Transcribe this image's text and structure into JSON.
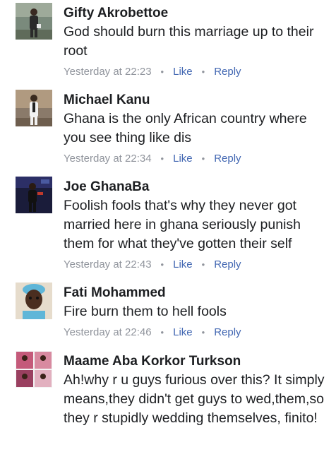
{
  "comments": [
    {
      "author": "Gifty Akrobettoe",
      "text": "God should burn this marriage up to their root",
      "time": "Yesterday at 22:23",
      "like": "Like",
      "reply": "Reply"
    },
    {
      "author": "Michael Kanu",
      "text": "Ghana is the only African country where you see thing like dis",
      "time": "Yesterday at 22:34",
      "like": "Like",
      "reply": "Reply"
    },
    {
      "author": "Joe GhanaBa",
      "text": "Foolish fools that's why they never got married here in ghana seriously punish them for what they've gotten their self",
      "time": "Yesterday at 22:43",
      "like": "Like",
      "reply": "Reply"
    },
    {
      "author": "Fati Mohammed",
      "text": "Fire burn them to hell fools",
      "time": "Yesterday at 22:46",
      "like": "Like",
      "reply": "Reply"
    },
    {
      "author": "Maame Aba Korkor Turkson",
      "text": "Ah!why r u guys furious over this? It simply means,they didn't get guys to wed,them,so they r stupidly wedding themselves, finito!"
    }
  ],
  "separator": "•"
}
